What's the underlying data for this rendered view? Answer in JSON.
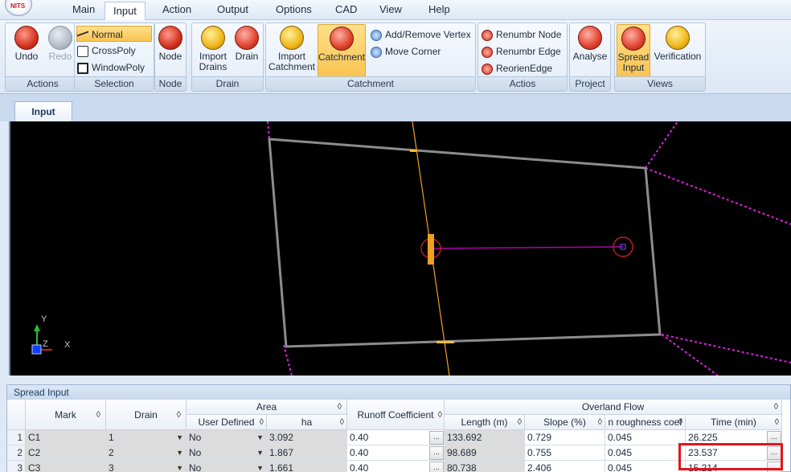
{
  "menu": {
    "logo_text": "NITS",
    "items": [
      "Main",
      "Input",
      "Action",
      "Output",
      "Options",
      "CAD",
      "View",
      "Help"
    ],
    "active": "Input"
  },
  "ribbon": {
    "groups": {
      "actions": "Actions",
      "selection": "Selection",
      "node": "Node",
      "drain": "Drain",
      "catchment": "Catchment",
      "actios": "Actios",
      "project": "Project",
      "views": "Views"
    },
    "buttons": {
      "undo": "Undo",
      "redo": "Redo",
      "normal": "Normal",
      "crosspoly": "CrossPoly",
      "windowpoly": "WindowPoly",
      "node": "Node",
      "import_drains_1": "Import",
      "import_drains_2": "Drains",
      "drain": "Drain",
      "import_catchment_1": "Import",
      "import_catchment_2": "Catchment",
      "catchment": "Catchment",
      "add_remove_vertex": "Add/Remove Vertex",
      "move_corner": "Move Corner",
      "renumbr_node": "Renumbr Node",
      "renumbr_edge": "Renumbr Edge",
      "reorien_edge": "ReorienEdge",
      "analyse": "Analyse",
      "spread_input_1": "Spread",
      "spread_input_2": "Input",
      "verification": "Verification"
    }
  },
  "document_tab": "Input",
  "axes": {
    "y": "Y",
    "z": "Z",
    "x": "X"
  },
  "colors": {
    "catchment_edge": "#8c8c8c",
    "drain_line": "#f0a020",
    "link_line": "#b000b0",
    "neighbor_edges": "#e020e0",
    "node_marker": "#e02020",
    "highlight": "#e3141e"
  },
  "spread": {
    "title": "Spread Input",
    "headers": {
      "mark": "Mark",
      "drain": "Drain",
      "area": "Area",
      "user_defined": "User Defined",
      "ha": "ha",
      "runoff_coefficient": "Runoff Coefficient",
      "overland_flow": "Overland Flow",
      "length": "Length (m)",
      "slope": "Slope (%)",
      "roughness": "n roughness coef",
      "time": "Time (min)"
    },
    "rows": [
      {
        "num": "1",
        "mark": "C1",
        "drain": "1",
        "user_defined": "No",
        "ha": "3.092",
        "runoff": "0.40",
        "length": "133.692",
        "slope": "0.729",
        "roughness": "0.045",
        "time": "26.225"
      },
      {
        "num": "2",
        "mark": "C2",
        "drain": "2",
        "user_defined": "No",
        "ha": "1.867",
        "runoff": "0.40",
        "length": "98.689",
        "slope": "0.755",
        "roughness": "0.045",
        "time": "23.537"
      },
      {
        "num": "3",
        "mark": "C3",
        "drain": "3",
        "user_defined": "No",
        "ha": "1.661",
        "runoff": "0.40",
        "length": "80.738",
        "slope": "2.406",
        "roughness": "0.045",
        "time": "15.214"
      }
    ],
    "ellipsis": "..."
  }
}
